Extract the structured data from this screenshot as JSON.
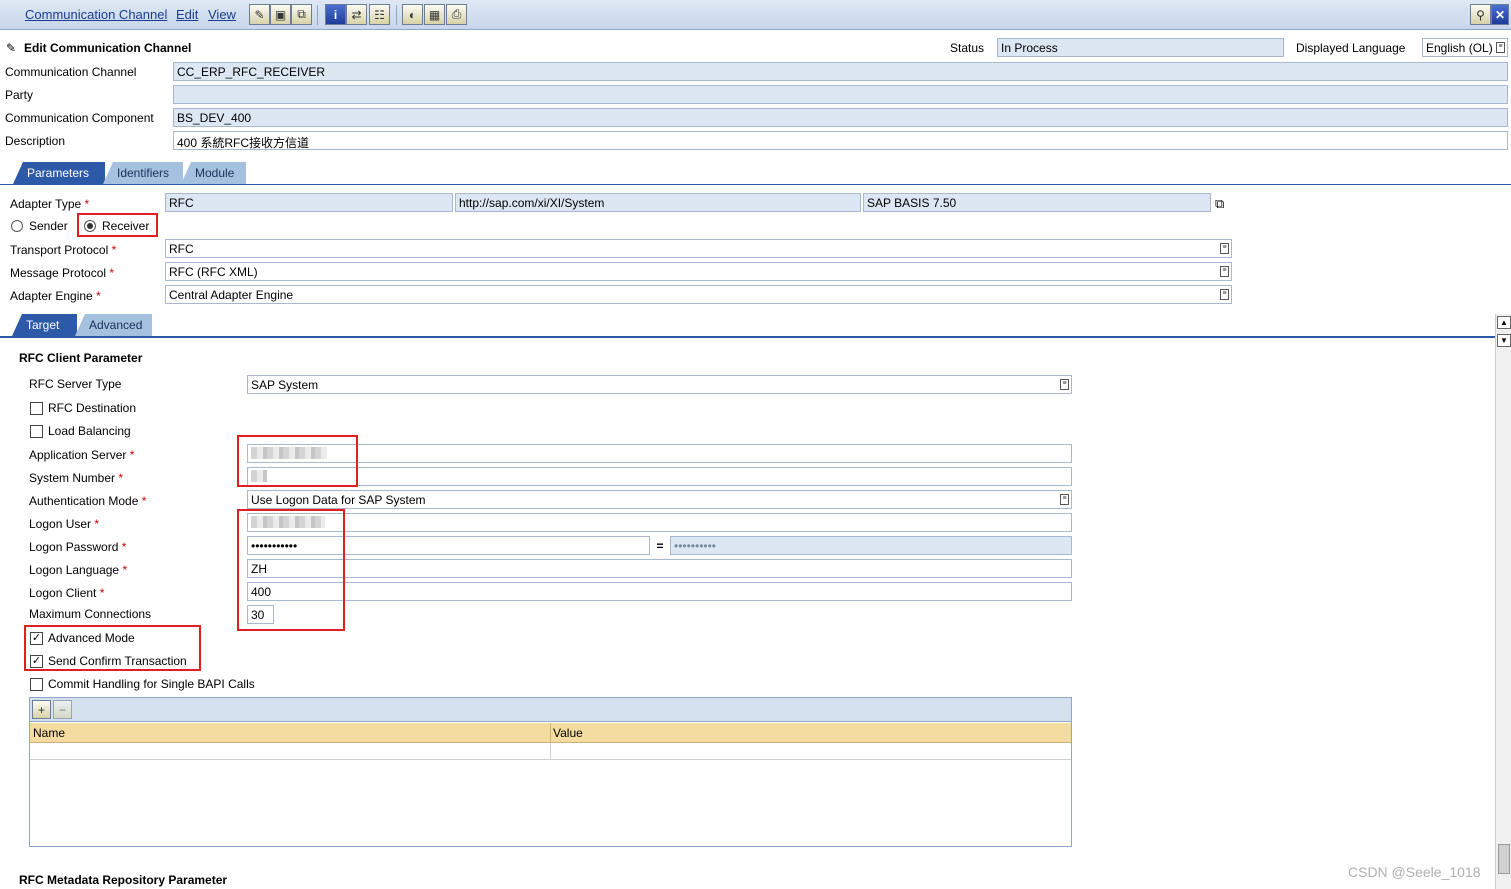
{
  "menu": {
    "items": [
      "Communication Channel",
      "Edit",
      "View"
    ]
  },
  "header": {
    "title": "Edit Communication Channel",
    "status_label": "Status",
    "status_value": "In Process",
    "language_label": "Displayed Language",
    "language_value": "English (OL)"
  },
  "fields": {
    "channel_label": "Communication Channel",
    "channel_value": "CC_ERP_RFC_RECEIVER",
    "party_label": "Party",
    "party_value": "",
    "component_label": "Communication Component",
    "component_value": "BS_DEV_400",
    "description_label": "Description",
    "description_value": "400 系統RFC接收方信道"
  },
  "tabs": [
    "Parameters",
    "Identifiers",
    "Module"
  ],
  "params": {
    "adapter_type_label": "Adapter Type",
    "adapter_type_values": [
      "RFC",
      "http://sap.com/xi/XI/System",
      "SAP BASIS 7.50"
    ],
    "sender_label": "Sender",
    "receiver_label": "Receiver",
    "transport_label": "Transport Protocol",
    "transport_value": "RFC",
    "message_label": "Message Protocol",
    "message_value": "RFC (RFC XML)",
    "engine_label": "Adapter Engine",
    "engine_value": "Central Adapter Engine",
    "required_mark": "*"
  },
  "subtabs": [
    "Target",
    "Advanced"
  ],
  "rfc": {
    "section_title": "RFC Client Parameter",
    "server_type_label": "RFC Server Type",
    "server_type_value": "SAP System",
    "rfc_destination_label": "RFC Destination",
    "load_balancing_label": "Load Balancing",
    "app_server_label": "Application Server",
    "system_number_label": "System Number",
    "auth_mode_label": "Authentication Mode",
    "auth_mode_value": "Use Logon Data for SAP System",
    "logon_user_label": "Logon User",
    "logon_password_label": "Logon Password",
    "logon_password_value": "•••••••••••",
    "logon_password_confirm": "••••••••••",
    "logon_language_label": "Logon Language",
    "logon_language_value": "ZH",
    "logon_client_label": "Logon Client",
    "logon_client_value": "400",
    "max_conn_label": "Maximum Connections",
    "max_conn_value": "30",
    "advanced_mode_label": "Advanced Mode",
    "send_confirm_label": "Send Confirm Transaction",
    "commit_label": "Commit Handling for Single BAPI Calls",
    "table_columns": [
      "Name",
      "Value"
    ],
    "metadata_title": "RFC Metadata Repository Parameter"
  },
  "watermark": "CSDN @Seele_1018"
}
